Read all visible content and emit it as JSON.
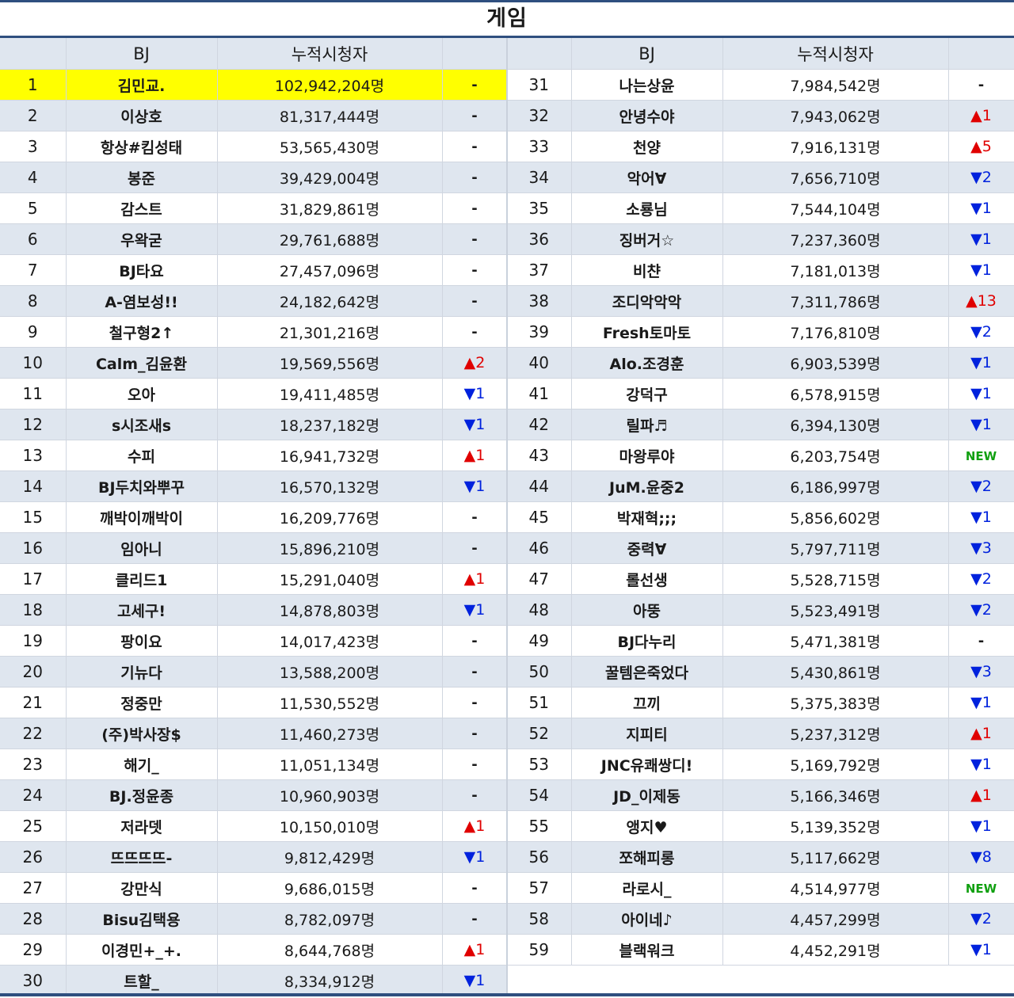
{
  "title": "게임",
  "headers": {
    "rank": "",
    "bj": "BJ",
    "count": "누적시청자",
    "change": ""
  },
  "colors": {
    "highlight": "#ffff00",
    "up": "#e00000",
    "down": "#0022dd",
    "new": "#11a011",
    "rule": "#2f4f7f"
  },
  "left": [
    {
      "rank": "1",
      "bj": "김민교.",
      "count": "102,942,204명",
      "change": "-",
      "type": "same"
    },
    {
      "rank": "2",
      "bj": "이상호",
      "count": "81,317,444명",
      "change": "-",
      "type": "same"
    },
    {
      "rank": "3",
      "bj": "항상#킴성태",
      "count": "53,565,430명",
      "change": "-",
      "type": "same"
    },
    {
      "rank": "4",
      "bj": "봉준",
      "count": "39,429,004명",
      "change": "-",
      "type": "same"
    },
    {
      "rank": "5",
      "bj": "감스트",
      "count": "31,829,861명",
      "change": "-",
      "type": "same"
    },
    {
      "rank": "6",
      "bj": "우왁굳",
      "count": "29,761,688명",
      "change": "-",
      "type": "same"
    },
    {
      "rank": "7",
      "bj": "BJ타요",
      "count": "27,457,096명",
      "change": "-",
      "type": "same"
    },
    {
      "rank": "8",
      "bj": "A-염보성!!",
      "count": "24,182,642명",
      "change": "-",
      "type": "same"
    },
    {
      "rank": "9",
      "bj": "철구형2↑",
      "count": "21,301,216명",
      "change": "-",
      "type": "same"
    },
    {
      "rank": "10",
      "bj": "Calm_김윤환",
      "count": "19,569,556명",
      "change": "▲2",
      "type": "up"
    },
    {
      "rank": "11",
      "bj": "오아",
      "count": "19,411,485명",
      "change": "▼1",
      "type": "down"
    },
    {
      "rank": "12",
      "bj": "s시조새s",
      "count": "18,237,182명",
      "change": "▼1",
      "type": "down"
    },
    {
      "rank": "13",
      "bj": "수피",
      "count": "16,941,732명",
      "change": "▲1",
      "type": "up"
    },
    {
      "rank": "14",
      "bj": "BJ두치와뿌꾸",
      "count": "16,570,132명",
      "change": "▼1",
      "type": "down"
    },
    {
      "rank": "15",
      "bj": "깨박이깨박이",
      "count": "16,209,776명",
      "change": "-",
      "type": "same"
    },
    {
      "rank": "16",
      "bj": "임아니",
      "count": "15,896,210명",
      "change": "-",
      "type": "same"
    },
    {
      "rank": "17",
      "bj": "클리드1",
      "count": "15,291,040명",
      "change": "▲1",
      "type": "up"
    },
    {
      "rank": "18",
      "bj": "고세구!",
      "count": "14,878,803명",
      "change": "▼1",
      "type": "down"
    },
    {
      "rank": "19",
      "bj": "팡이요",
      "count": "14,017,423명",
      "change": "-",
      "type": "same"
    },
    {
      "rank": "20",
      "bj": "기뉴다",
      "count": "13,588,200명",
      "change": "-",
      "type": "same"
    },
    {
      "rank": "21",
      "bj": "정중만",
      "count": "11,530,552명",
      "change": "-",
      "type": "same"
    },
    {
      "rank": "22",
      "bj": "(주)박사장$",
      "count": "11,460,273명",
      "change": "-",
      "type": "same"
    },
    {
      "rank": "23",
      "bj": "해기_",
      "count": "11,051,134명",
      "change": "-",
      "type": "same"
    },
    {
      "rank": "24",
      "bj": "BJ.정윤종",
      "count": "10,960,903명",
      "change": "-",
      "type": "same"
    },
    {
      "rank": "25",
      "bj": "저라뎃",
      "count": "10,150,010명",
      "change": "▲1",
      "type": "up"
    },
    {
      "rank": "26",
      "bj": "뜨뜨뜨뜨-",
      "count": "9,812,429명",
      "change": "▼1",
      "type": "down"
    },
    {
      "rank": "27",
      "bj": "강만식",
      "count": "9,686,015명",
      "change": "-",
      "type": "same"
    },
    {
      "rank": "28",
      "bj": "Bisu김택용",
      "count": "8,782,097명",
      "change": "-",
      "type": "same"
    },
    {
      "rank": "29",
      "bj": "이경민+_+.",
      "count": "8,644,768명",
      "change": "▲1",
      "type": "up"
    },
    {
      "rank": "30",
      "bj": "트할_",
      "count": "8,334,912명",
      "change": "▼1",
      "type": "down"
    }
  ],
  "right": [
    {
      "rank": "31",
      "bj": "나는상윤",
      "count": "7,984,542명",
      "change": "-",
      "type": "same"
    },
    {
      "rank": "32",
      "bj": "안녕수야",
      "count": "7,943,062명",
      "change": "▲1",
      "type": "up"
    },
    {
      "rank": "33",
      "bj": "천양",
      "count": "7,916,131명",
      "change": "▲5",
      "type": "up"
    },
    {
      "rank": "34",
      "bj": "악어∀",
      "count": "7,656,710명",
      "change": "▼2",
      "type": "down"
    },
    {
      "rank": "35",
      "bj": "소룡님",
      "count": "7,544,104명",
      "change": "▼1",
      "type": "down"
    },
    {
      "rank": "36",
      "bj": "징버거☆",
      "count": "7,237,360명",
      "change": "▼1",
      "type": "down"
    },
    {
      "rank": "37",
      "bj": "비챤",
      "count": "7,181,013명",
      "change": "▼1",
      "type": "down"
    },
    {
      "rank": "38",
      "bj": "조디악악악",
      "count": "7,311,786명",
      "change": "▲13",
      "type": "up"
    },
    {
      "rank": "39",
      "bj": "Fresh토마토",
      "count": "7,176,810명",
      "change": "▼2",
      "type": "down"
    },
    {
      "rank": "40",
      "bj": "Alo.조경훈",
      "count": "6,903,539명",
      "change": "▼1",
      "type": "down"
    },
    {
      "rank": "41",
      "bj": "강덕구",
      "count": "6,578,915명",
      "change": "▼1",
      "type": "down"
    },
    {
      "rank": "42",
      "bj": "릴파♬",
      "count": "6,394,130명",
      "change": "▼1",
      "type": "down"
    },
    {
      "rank": "43",
      "bj": "마왕루야",
      "count": "6,203,754명",
      "change": "NEW",
      "type": "new"
    },
    {
      "rank": "44",
      "bj": "JuM.윤중2",
      "count": "6,186,997명",
      "change": "▼2",
      "type": "down"
    },
    {
      "rank": "45",
      "bj": "박재혁;;;",
      "count": "5,856,602명",
      "change": "▼1",
      "type": "down"
    },
    {
      "rank": "46",
      "bj": "중력∀",
      "count": "5,797,711명",
      "change": "▼3",
      "type": "down"
    },
    {
      "rank": "47",
      "bj": "롤선생",
      "count": "5,528,715명",
      "change": "▼2",
      "type": "down"
    },
    {
      "rank": "48",
      "bj": "아뚱",
      "count": "5,523,491명",
      "change": "▼2",
      "type": "down"
    },
    {
      "rank": "49",
      "bj": "BJ다누리",
      "count": "5,471,381명",
      "change": "-",
      "type": "same"
    },
    {
      "rank": "50",
      "bj": "꿀템은죽었다",
      "count": "5,430,861명",
      "change": "▼3",
      "type": "down"
    },
    {
      "rank": "51",
      "bj": "끄끼",
      "count": "5,375,383명",
      "change": "▼1",
      "type": "down"
    },
    {
      "rank": "52",
      "bj": "지피티",
      "count": "5,237,312명",
      "change": "▲1",
      "type": "up"
    },
    {
      "rank": "53",
      "bj": "JNC유쾌쌍디!",
      "count": "5,169,792명",
      "change": "▼1",
      "type": "down"
    },
    {
      "rank": "54",
      "bj": "JD_이제동",
      "count": "5,166,346명",
      "change": "▲1",
      "type": "up"
    },
    {
      "rank": "55",
      "bj": "앵지♥",
      "count": "5,139,352명",
      "change": "▼1",
      "type": "down"
    },
    {
      "rank": "56",
      "bj": "쪼해피롱",
      "count": "5,117,662명",
      "change": "▼8",
      "type": "down"
    },
    {
      "rank": "57",
      "bj": "라로시_",
      "count": "4,514,977명",
      "change": "NEW",
      "type": "new"
    },
    {
      "rank": "58",
      "bj": "아이네♪",
      "count": "4,457,299명",
      "change": "▼2",
      "type": "down"
    },
    {
      "rank": "59",
      "bj": "블랙워크",
      "count": "4,452,291명",
      "change": "▼1",
      "type": "down"
    }
  ]
}
